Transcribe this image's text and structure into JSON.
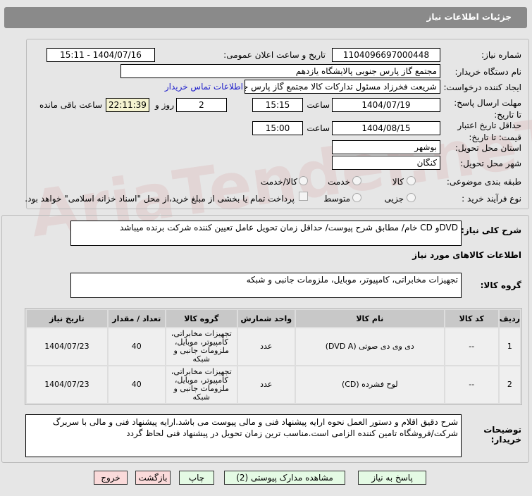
{
  "header": {
    "title": "جزئیات اطلاعات نیاز"
  },
  "watermark": "AriaTender.neT",
  "form": {
    "need_number_label": "شماره نیاز:",
    "need_number": "1104096697000448",
    "announce_label": "تاریخ و ساعت اعلان عمومی:",
    "announce_value": "1404/07/16 - 15:11",
    "buyer_label": "نام دستگاه خریدار:",
    "buyer_value": "مجتمع گاز پارس جنوبی  پالایشگاه یازدهم",
    "creator_label": "ایجاد کننده درخواست:",
    "creator_value": "شریعت فخرزاد مسئول تدارکات کالا مجتمع گاز پارس جنوبی  پالایشگاه یازدهم",
    "contact_link": "اطلاعات تماس خریدار",
    "deadline_label": "مهلت ارسال پاسخ: تا تاریخ:",
    "deadline_date": "1404/07/19",
    "time_label": "ساعت",
    "deadline_time": "15:15",
    "days": "2",
    "days_label": "روز و",
    "remaining": "22:11:39",
    "remaining_label": "ساعت باقی مانده",
    "validity_label": "حداقل تاریخ اعتبار قیمت: تا تاریخ:",
    "validity_date": "1404/08/15",
    "validity_time": "15:00",
    "province_label": "استان محل تحویل:",
    "province": "بوشهر",
    "city_label": "شهر محل تحویل:",
    "city": "کنگان",
    "category_label": "طبقه بندی موضوعی:",
    "category_options": [
      "کالا",
      "خدمت",
      "کالا/خدمت"
    ],
    "process_label": "نوع فرآیند خرید :",
    "process_options": [
      "جزیی",
      "متوسط"
    ],
    "payment_note": "پرداخت تمام یا بخشی از مبلغ خرید،از محل \"اسناد خزانه اسلامی\" خواهد بود."
  },
  "summary": {
    "label": "شرح کلی نیاز:",
    "value": "DVDو CD خام/ مطابق شرح پیوست/ حداقل زمان تحویل عامل تعیین کننده شرکت برنده میباشد"
  },
  "items_title": "اطلاعات کالاهای مورد نیاز",
  "group": {
    "label": "گروه کالا:",
    "value": "تجهیزات مخابراتی، کامپیوتر، موبایل، ملزومات جانبی و شبکه"
  },
  "table": {
    "headers": [
      "ردیف",
      "کد کالا",
      "نام کالا",
      "واحد شمارش",
      "گروه کالا",
      "تعداد / مقدار",
      "تاریخ نیاز"
    ],
    "rows": [
      [
        "1",
        "--",
        "دی وی دی صوتی (DVD A)",
        "عدد",
        "تجهیزات مخابراتی، کامپیوتر، موبایل، ملزومات جانبی و شبکه",
        "40",
        "1404/07/23"
      ],
      [
        "2",
        "--",
        "لوح فشرده (CD)",
        "عدد",
        "تجهیزات مخابراتی، کامپیوتر، موبایل، ملزومات جانبی و شبکه",
        "40",
        "1404/07/23"
      ]
    ]
  },
  "notes": {
    "label": "توضیحات خریدار:",
    "value": "شرح دقیق اقلام و دستور العمل نحوه ارایه پیشنهاد فنی و مالی پیوست می باشد.ارایه پیشنهاد فنی و مالی با سربرگ شرکت/فروشگاه تامین کننده الزامی است.مناسب ترین زمان تحویل در پیشنهاد فنی لحاظ گردد"
  },
  "buttons": {
    "reply": "پاسخ به نیاز",
    "attachments": "مشاهده مدارک پیوستی (2)",
    "print": "چاپ",
    "back": "بازگشت",
    "exit": "خروج"
  }
}
